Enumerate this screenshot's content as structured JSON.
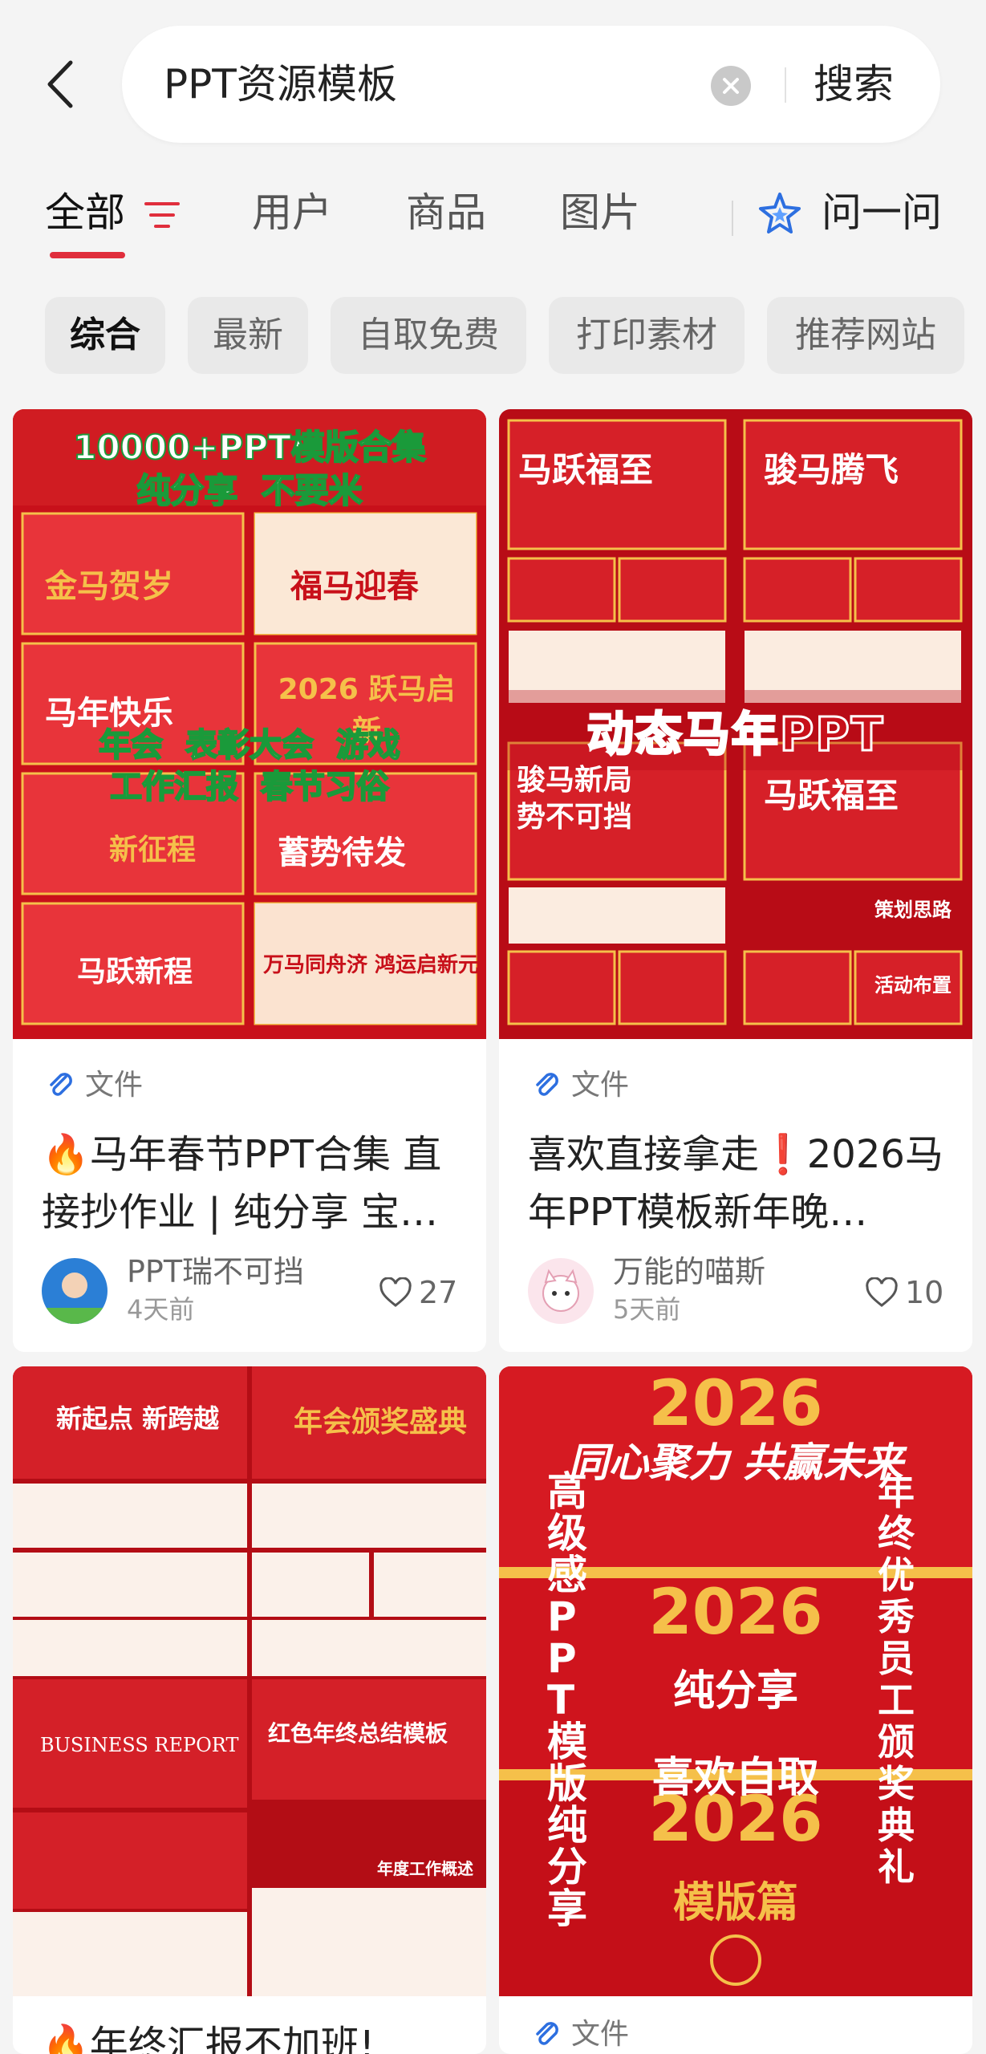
{
  "search": {
    "query": "PPT资源模板",
    "submit_label": "搜索"
  },
  "tabs": [
    {
      "label": "全部",
      "active": true
    },
    {
      "label": "用户"
    },
    {
      "label": "商品"
    },
    {
      "label": "图片"
    }
  ],
  "ask": {
    "label": "问一问",
    "icon": "sparkle-star-icon"
  },
  "chips": [
    {
      "label": "综合",
      "active": true
    },
    {
      "label": "最新"
    },
    {
      "label": "自取免费"
    },
    {
      "label": "打印素材"
    },
    {
      "label": "推荐网站"
    }
  ],
  "colors": {
    "accent": "#e02e3c",
    "ask_icon": "#2d6fe0",
    "poster_red": "#c8101a",
    "poster_gold": "#f5c04a"
  },
  "cards": [
    {
      "type_label": "文件",
      "title": "🔥马年春节PPT合集 直接抄作业 | 纯分享 宝…",
      "author": "PPT瑞不可挡",
      "time": "4天前",
      "likes": "27",
      "image_text": {
        "banner1": "10000+PPT模版合集",
        "banner2": "纯分享  不要米",
        "line1": "年会  表彰大会  游戏",
        "line2": "工作汇报  春节习俗",
        "tiles": [
          "金马贺岁",
          "福马迎春",
          "马年快乐",
          "2026 跃马启新",
          "新征程",
          "蓄势待发",
          "马跃新程",
          "万马同舟济 鸿运启新元"
        ]
      }
    },
    {
      "type_label": "文件",
      "title": "喜欢直接拿走❗️2026马年PPT模板新年晚…",
      "author": "万能的喵斯",
      "time": "5天前",
      "likes": "10",
      "image_text": {
        "headline": "动态马年PPT",
        "tiles": [
          "马跃福至",
          "骏马腾飞",
          "骏马新局 势不可挡",
          "马跃福至",
          "策划思路",
          "活动布置"
        ]
      }
    },
    {
      "type_label": "",
      "title": "🔥年终汇报不加班!",
      "image_text": {
        "tiles": [
          "新起点 新跨越",
          "年会颁奖盛典",
          "BUSINESS REPORT",
          "红色年终总结模板",
          "年度工作概述"
        ]
      }
    },
    {
      "type_label": "文件",
      "image_text": {
        "top": "同心聚力 共赢未来",
        "left": "高级感PPT模版纯分享",
        "right": "年终优秀员工颁奖典礼",
        "mid1": "纯分享",
        "mid2": "喜欢自取",
        "mid3": "模版篇",
        "year": "2026"
      }
    }
  ]
}
